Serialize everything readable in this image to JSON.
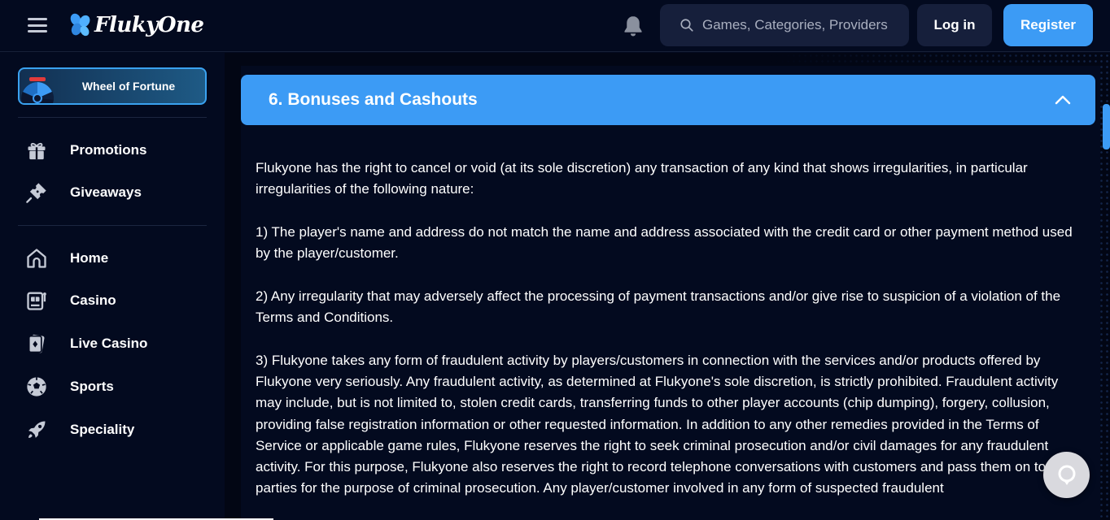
{
  "header": {
    "logo_text": "FlukyOne",
    "search_placeholder": "Games, Categories, Providers",
    "login_label": "Log in",
    "register_label": "Register"
  },
  "sidebar": {
    "featured_label": "Wheel of Fortune",
    "group1": [
      {
        "label": "Promotions",
        "icon": "gift-icon"
      },
      {
        "label": "Giveaways",
        "icon": "ticket-icon"
      }
    ],
    "group2": [
      {
        "label": "Home",
        "icon": "home-icon"
      },
      {
        "label": "Casino",
        "icon": "slot-machine-icon"
      },
      {
        "label": "Live Casino",
        "icon": "cards-icon"
      },
      {
        "label": "Sports",
        "icon": "soccer-ball-icon"
      },
      {
        "label": "Speciality",
        "icon": "rocket-icon"
      }
    ]
  },
  "main": {
    "section_title": "6. Bonuses and Cashouts",
    "paragraphs": [
      "Flukyone has the right to cancel or void (at its sole discretion) any transaction of any kind that shows irregularities, in particular irregularities of the following nature:",
      "1) The player's name and address do not match the name and address associated with the credit card or other payment method used by the player/customer.",
      "2) Any irregularity that may adversely affect the processing of payment transactions and/or give rise to suspicion of a violation of the Terms and Conditions.",
      "3) Flukyone takes any form of fraudulent activity by players/customers in connection with the services and/or products offered by Flukyone very seriously. Any fraudulent activity, as determined at Flukyone's sole discretion, is strictly prohibited. Fraudulent activity may include, but is not limited to, stolen credit cards, transferring funds to other player accounts (chip dumping), forgery, collusion, providing false registration information or other requested information. In addition to any other remedies provided in the Terms of Service or applicable game rules, Flukyone reserves the right to seek criminal prosecution and/or civil damages for any fraudulent activity. For this purpose, Flukyone also reserves the right to record telephone conversations with customers and pass them on to third parties for the purpose of criminal prosecution. Any player/customer involved in any form of suspected fraudulent"
    ]
  },
  "colors": {
    "accent": "#3c9bf5",
    "background": "#030a1f",
    "surface": "#161f3b"
  }
}
